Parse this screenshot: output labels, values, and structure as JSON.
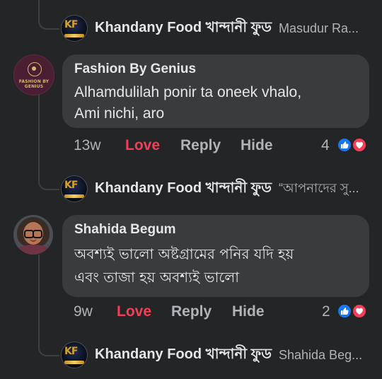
{
  "comments": {
    "reply_to_first": {
      "page_name": "Khandany Food খান্দানী ফুড",
      "preview": "Masudur Ra..."
    },
    "fashion_by_genius": {
      "author": "Fashion By Genius",
      "avatar_logo_text": "FASHION BY GENIUS",
      "text": "Alhamdulilah ponir ta oneek vhalo,\nAmi nichi, aro",
      "time": "13w",
      "love_label": "Love",
      "reply_label": "Reply",
      "hide_label": "Hide",
      "reaction_count": "4"
    },
    "reply_to_fashion": {
      "page_name": "Khandany Food খান্দানী ফুড",
      "preview": "“আপনাদের সু..."
    },
    "shahida_begum": {
      "author": "Shahida Begum",
      "text": "অবশ্যই ভালো অষ্টগ্রামের পনির যদি হয়\nএবং তাজা হয় অবশ্যই ভালো",
      "time": "9w",
      "love_label": "Love",
      "reply_label": "Reply",
      "hide_label": "Hide",
      "reaction_count": "2"
    },
    "reply_to_shahida": {
      "page_name": "Khandany Food খান্দানী ফুড",
      "preview": "Shahida Beg..."
    }
  },
  "colors": {
    "background": "#242526",
    "comment_bubble": "#3a3b3c",
    "text": "#e4e6eb",
    "secondary_text": "#b0b3b8",
    "love": "#f33e58",
    "like": "#1877f2",
    "thread_line": "#3e4042"
  },
  "icons": {
    "like": "thumbs-up-icon",
    "love": "heart-icon",
    "page_logo": "khandany-food-logo-icon"
  }
}
